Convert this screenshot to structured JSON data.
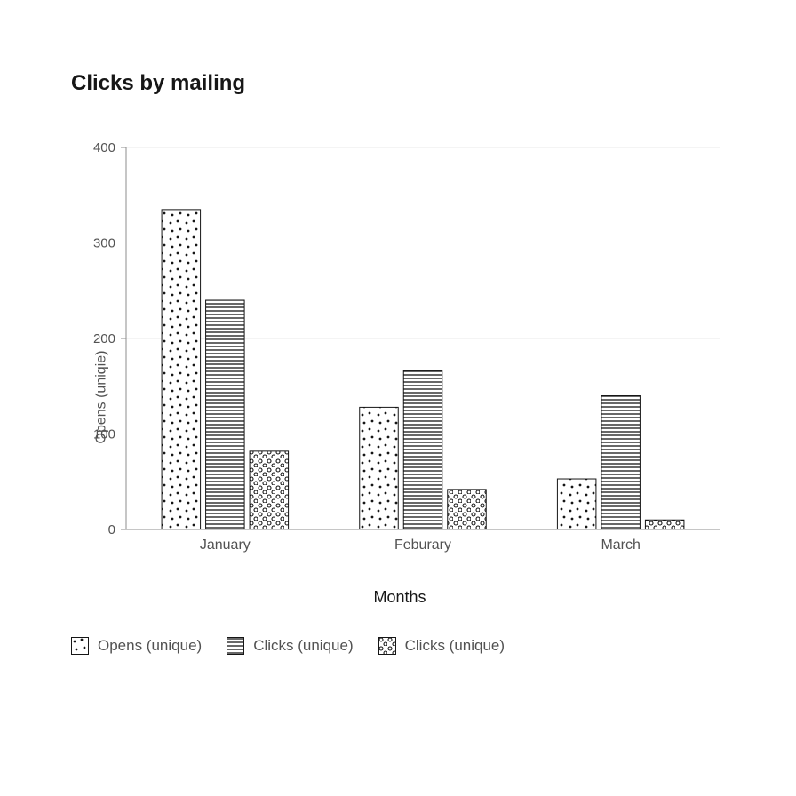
{
  "chart_data": {
    "type": "bar",
    "title": "Clicks by mailing",
    "xlabel": "Months",
    "ylabel": "Opens (uniqie)",
    "ylim": [
      0,
      400
    ],
    "yticks": [
      0,
      100,
      200,
      300,
      400
    ],
    "categories": [
      "January",
      "Feburary",
      "March"
    ],
    "series": [
      {
        "name": "Opens (unique)",
        "pattern": "dots-sparse",
        "values": [
          335,
          128,
          53
        ]
      },
      {
        "name": "Clicks (unique)",
        "pattern": "h-lines",
        "values": [
          240,
          166,
          140
        ]
      },
      {
        "name": "Clicks (unique)",
        "pattern": "dots-dense",
        "values": [
          82,
          42,
          10
        ]
      }
    ],
    "legend_position": "bottom"
  }
}
